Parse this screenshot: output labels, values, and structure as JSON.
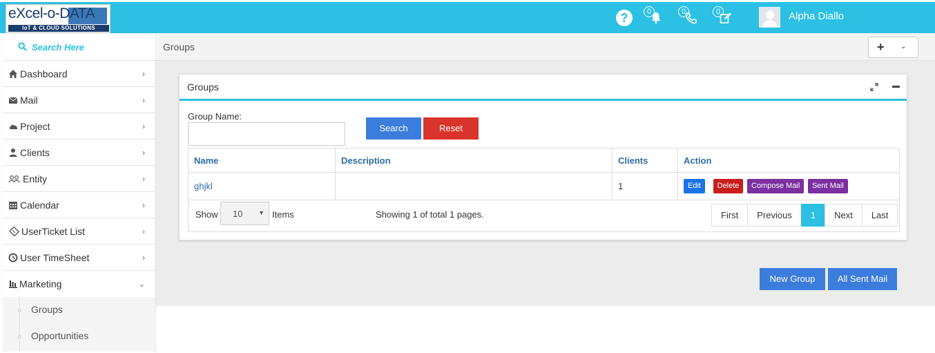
{
  "header": {
    "logo": {
      "main": "eXcel-o-DATA",
      "tagline": "IoT & CLOUD SOLUTIONS"
    },
    "help_icon": "question-circle-icon",
    "notifications": [
      {
        "icon": "bell-icon",
        "count": "0"
      },
      {
        "icon": "phone-icon",
        "count": "0"
      },
      {
        "icon": "edit-icon",
        "count": "0"
      }
    ],
    "user_name": "Alpha Diallo"
  },
  "sidebar": {
    "search_placeholder": "Search Here",
    "items": [
      {
        "label": "Dashboard",
        "icon": "home-icon"
      },
      {
        "label": "Mail",
        "icon": "envelope-icon"
      },
      {
        "label": "Project",
        "icon": "cloud-icon"
      },
      {
        "label": "Clients",
        "icon": "user-icon"
      },
      {
        "label": "Entity",
        "icon": "users-icon"
      },
      {
        "label": "Calendar",
        "icon": "calendar-icon"
      },
      {
        "label": "UserTicket List",
        "icon": "ticket-icon"
      },
      {
        "label": "User TimeSheet",
        "icon": "clock-icon"
      },
      {
        "label": "Marketing",
        "icon": "bar-chart-icon"
      }
    ],
    "submenu": [
      "Groups",
      "Opportunities"
    ]
  },
  "page_bar": {
    "breadcrumb": "Groups",
    "plus": "+",
    "chevron": "⌄"
  },
  "portlet": {
    "title": "Groups",
    "group_name_label": "Group Name:",
    "group_name_value": "",
    "search_label": "Search",
    "reset_label": "Reset",
    "columns": [
      "Name",
      "Description",
      "Clients",
      "Action"
    ],
    "rows": [
      {
        "name": "ghjkl",
        "description": "",
        "clients": "1"
      }
    ],
    "actions": {
      "edit": "Edit",
      "delete": "Delete",
      "compose": "Compose Mail",
      "sent": "Sent Mail"
    },
    "show_label": "Show",
    "page_size": "10",
    "items_label": "Items",
    "showing_text": "Showing 1 of total 1 pages.",
    "pager": [
      "First",
      "Previous",
      "1",
      "Next",
      "Last"
    ],
    "current_page": "1"
  },
  "footer_buttons": {
    "new_group": "New Group",
    "all_sent_mail": "All Sent Mail"
  },
  "colors": {
    "accent": "#2bc0e4",
    "primary": "#3b7ddd",
    "danger": "#d9342b",
    "purple": "#7b2fa0"
  }
}
